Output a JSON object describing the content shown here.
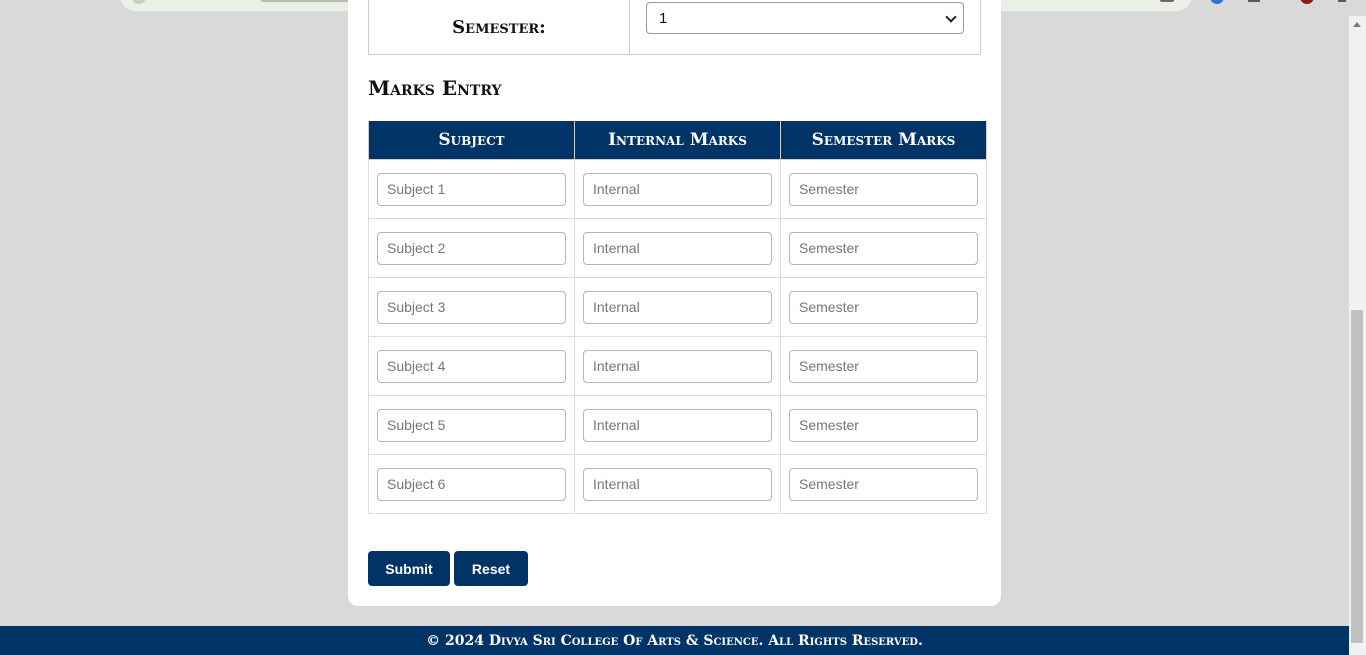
{
  "semester": {
    "label": "Semester:",
    "selected": "1"
  },
  "marks_entry": {
    "title": "Marks Entry",
    "columns": [
      "Subject",
      "Internal Marks",
      "Semester Marks"
    ],
    "rows": [
      {
        "subject_placeholder": "Subject 1",
        "internal_placeholder": "Internal",
        "semester_placeholder": "Semester"
      },
      {
        "subject_placeholder": "Subject 2",
        "internal_placeholder": "Internal",
        "semester_placeholder": "Semester"
      },
      {
        "subject_placeholder": "Subject 3",
        "internal_placeholder": "Internal",
        "semester_placeholder": "Semester"
      },
      {
        "subject_placeholder": "Subject 4",
        "internal_placeholder": "Internal",
        "semester_placeholder": "Semester"
      },
      {
        "subject_placeholder": "Subject 5",
        "internal_placeholder": "Internal",
        "semester_placeholder": "Semester"
      },
      {
        "subject_placeholder": "Subject 6",
        "internal_placeholder": "Internal",
        "semester_placeholder": "Semester"
      }
    ]
  },
  "buttons": {
    "submit": "Submit",
    "reset": "Reset"
  },
  "footer": {
    "text": "© 2024 Divya Sri College Of Arts & Science. All Rights Reserved."
  },
  "colors": {
    "primary": "#003366",
    "page_background": "#d9d9d9"
  }
}
